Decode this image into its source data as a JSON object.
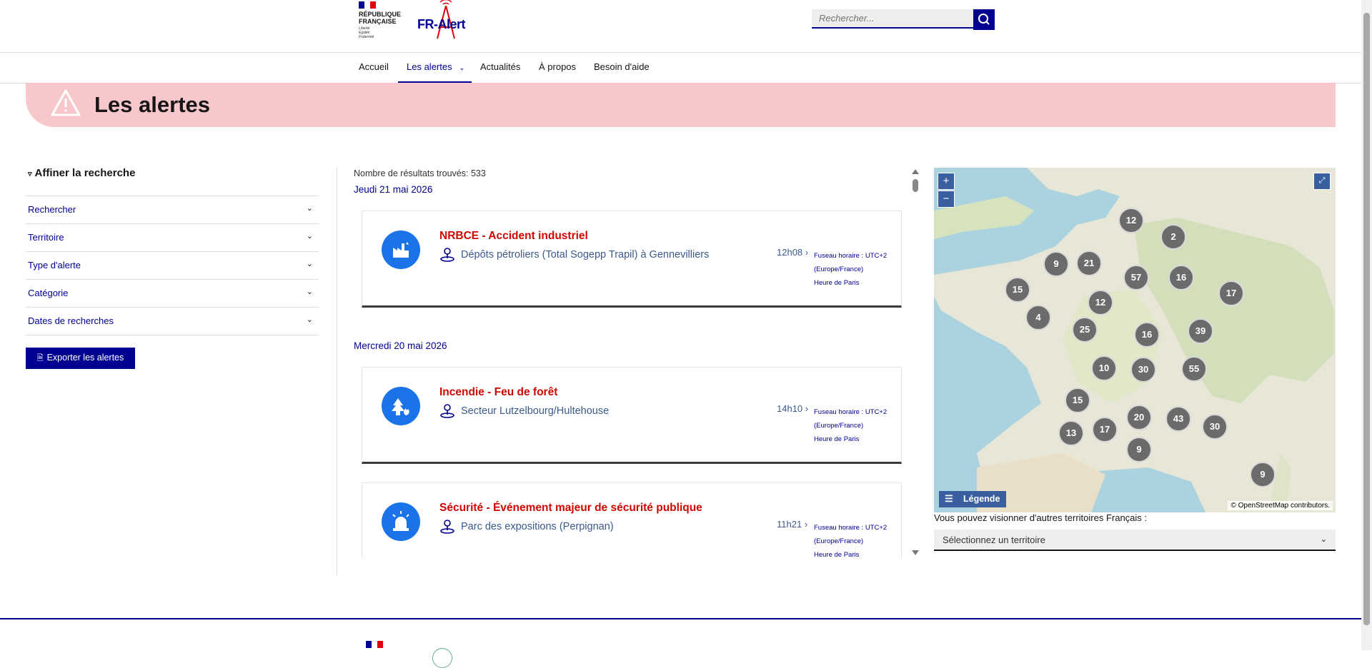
{
  "header": {
    "rf_logo_lines": [
      "RÉPUBLIQUE",
      "FRANÇAISE"
    ],
    "rf_motto": [
      "Liberté",
      "Égalité",
      "Fraternité"
    ],
    "fr_alert_logo": "FR-Alert",
    "search": {
      "placeholder": "Rechercher..."
    }
  },
  "nav": {
    "items": [
      {
        "label": "Accueil"
      },
      {
        "label": "Les alertes",
        "active": true
      },
      {
        "label": "Actualités"
      },
      {
        "label": "À propos"
      },
      {
        "label": "Besoin d'aide"
      }
    ]
  },
  "banner": {
    "title": "Les alertes",
    "icon": "warning-triangle-icon"
  },
  "sidebar": {
    "title": "Affiner la recherche",
    "filters": [
      {
        "label": "Rechercher"
      },
      {
        "label": "Territoire"
      },
      {
        "label": "Type d'alerte"
      },
      {
        "label": "Catégorie"
      },
      {
        "label": "Dates de recherches"
      }
    ],
    "export_label": "Exporter les alertes"
  },
  "results": {
    "count_label": "Nombre de résultats trouvés: 533",
    "groups": [
      {
        "date": "Jeudi 21 mai 2026",
        "alerts": [
          {
            "title": "NRBCE - Accident industriel",
            "location": "Dépôts pétroliers (Total Sogepp Trapil) à Gennevilliers",
            "time": "12h08",
            "tz1": "Fuseau horaire : UTC+2",
            "tz2": "(Europe/France)",
            "tz3": "Heure de Paris",
            "icon": "factory-icon"
          }
        ]
      },
      {
        "date": "Mercredi 20 mai 2026",
        "alerts": [
          {
            "title": "Incendie - Feu de forêt",
            "location": "Secteur Lutzelbourg/Hultehouse",
            "time": "14h10",
            "tz1": "Fuseau horaire : UTC+2",
            "tz2": "(Europe/France)",
            "tz3": "Heure de Paris",
            "icon": "forest-fire-icon"
          },
          {
            "title": "Sécurité - Événement majeur de sécurité publique",
            "location": "Parc des expositions (Perpignan)",
            "time": "11h21",
            "tz1": "Fuseau horaire : UTC+2",
            "tz2": "(Europe/France)",
            "tz3": "Heure de Paris",
            "icon": "siren-icon"
          }
        ]
      }
    ]
  },
  "map": {
    "zoom_in": "+",
    "zoom_out": "−",
    "legend_label": "Légende",
    "attribution": "© OpenStreetMap contributors.",
    "clusters": [
      "12",
      "2",
      "9",
      "21",
      "57",
      "16",
      "15",
      "12",
      "17",
      "4",
      "25",
      "16",
      "39",
      "10",
      "30",
      "55",
      "15",
      "20",
      "43",
      "30",
      "13",
      "17",
      "9",
      "9"
    ],
    "caption": "Vous pouvez visionner d'autres territoires Français :",
    "select_value": "Sélectionnez un territoire"
  },
  "colors": {
    "brand_blue": "#000091",
    "alert_red": "#ce0500",
    "banner_pink": "#f7c7cb",
    "icon_blue": "#1a73e8"
  }
}
